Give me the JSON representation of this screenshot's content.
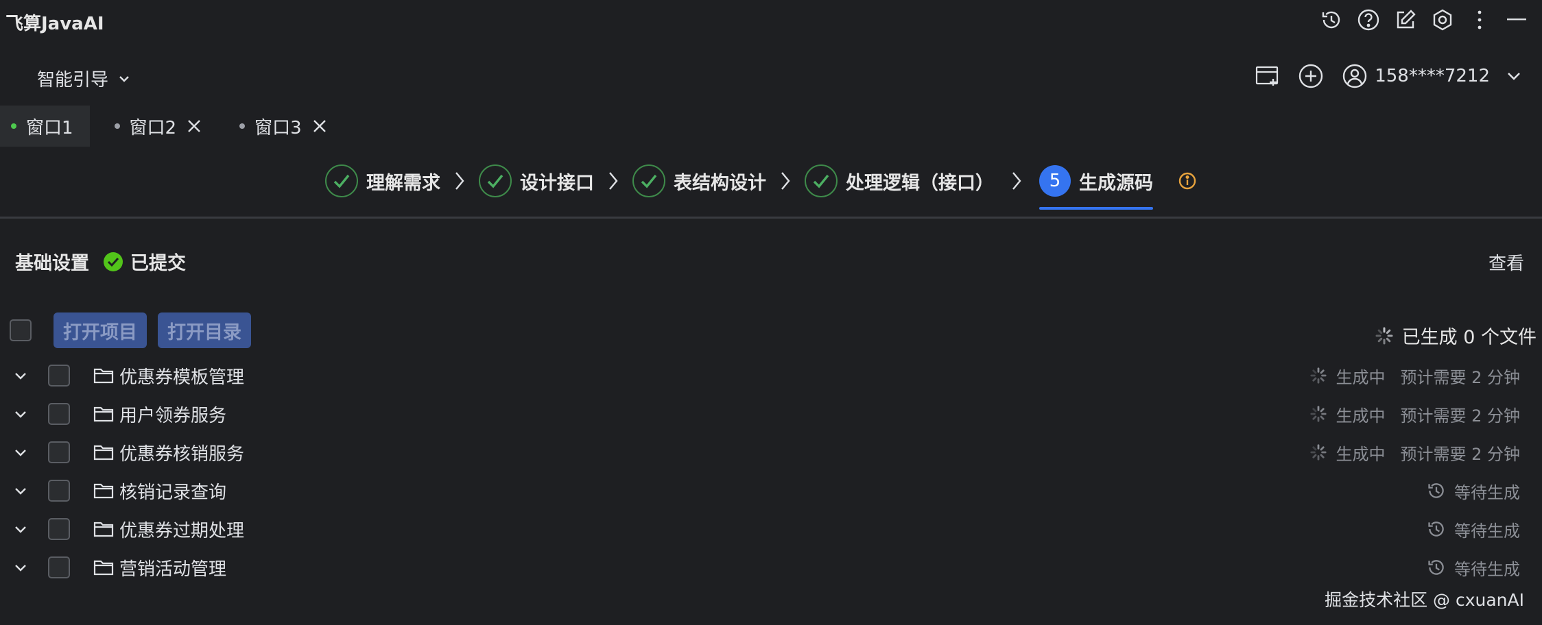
{
  "app": {
    "title": "飞算JavaAI"
  },
  "guide": {
    "label": "智能引导",
    "user_phone": "158****7212"
  },
  "tabs": [
    {
      "label": "窗口1",
      "active": true
    },
    {
      "label": "窗口2",
      "active": false
    },
    {
      "label": "窗口3",
      "active": false
    }
  ],
  "steps": [
    {
      "label": "理解需求",
      "state": "done"
    },
    {
      "label": "设计接口",
      "state": "done"
    },
    {
      "label": "表结构设计",
      "state": "done"
    },
    {
      "label": "处理逻辑（接口）",
      "state": "done"
    },
    {
      "label": "生成源码",
      "state": "current",
      "number": "5"
    }
  ],
  "base": {
    "title": "基础设置",
    "status": "已提交",
    "view": "查看"
  },
  "toolbar": {
    "open_project": "打开项目",
    "open_dir": "打开目录",
    "generated": "已生成 0 个文件"
  },
  "modules": [
    {
      "name": "优惠券模板管理",
      "status": "生成中",
      "eta": "预计需要 2 分钟",
      "state": "generating"
    },
    {
      "name": "用户领券服务",
      "status": "生成中",
      "eta": "预计需要 2 分钟",
      "state": "generating"
    },
    {
      "name": "优惠券核销服务",
      "status": "生成中",
      "eta": "预计需要 2 分钟",
      "state": "generating"
    },
    {
      "name": "核销记录查询",
      "status": "等待生成",
      "eta": "",
      "state": "waiting"
    },
    {
      "name": "优惠券过期处理",
      "status": "等待生成",
      "eta": "",
      "state": "waiting"
    },
    {
      "name": "营销活动管理",
      "status": "等待生成",
      "eta": "",
      "state": "waiting"
    }
  ],
  "watermark": "掘金技术社区 @ cxuanAI",
  "colors": {
    "accent": "#3574f0",
    "success": "#4ec94e",
    "warning": "#e8a33d",
    "button": "#3a5493"
  }
}
